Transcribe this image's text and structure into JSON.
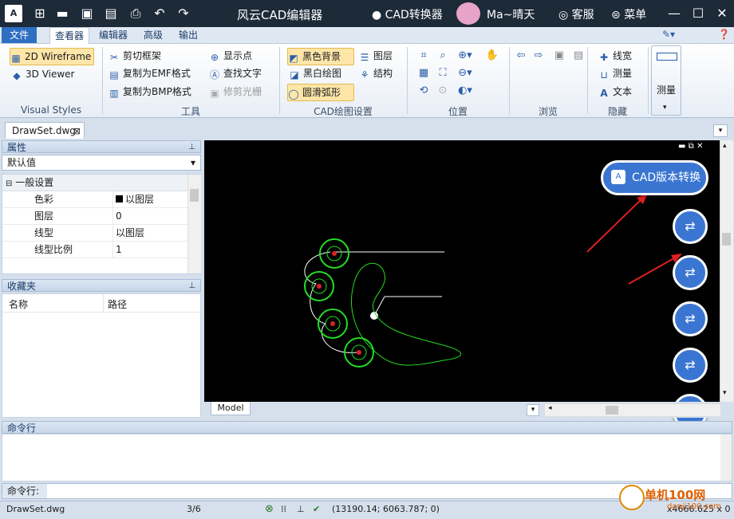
{
  "titlebar": {
    "logo": "A",
    "title": "风云CAD编辑器",
    "converter": "CAD转换器",
    "user": "Ma~晴天",
    "support": "客服",
    "menu": "菜单",
    "toolbar_icons": [
      "new-file-icon",
      "open-folder-icon",
      "save-icon",
      "save-as-icon",
      "print-icon",
      "undo-icon",
      "redo-icon"
    ]
  },
  "menubar": {
    "tabs": [
      "文件",
      "查看器",
      "编辑器",
      "高级",
      "输出"
    ],
    "active": "查看器"
  },
  "ribbon": {
    "visual_styles": {
      "label": "Visual Styles",
      "items": [
        "2D Wireframe",
        "3D Viewer"
      ]
    },
    "tools": {
      "label": "工具",
      "items": [
        "剪切框架",
        "复制为EMF格式",
        "复制为BMP格式",
        "显示点",
        "查找文字",
        "修剪光栅"
      ]
    },
    "cad_settings": {
      "label": "CAD绘图设置",
      "items": [
        "黑色背景",
        "黑白绘图",
        "圆滑弧形",
        "图层",
        "结构"
      ]
    },
    "position": {
      "label": "位置"
    },
    "browse": {
      "label": "浏览"
    },
    "hide": {
      "label": "隐藏",
      "items": [
        "线宽",
        "测量",
        "文本"
      ]
    },
    "measure": {
      "label": "测量"
    }
  },
  "document": {
    "tab": "DrawSet.dwg"
  },
  "properties": {
    "title": "属性",
    "dropdown": "默认值",
    "section": "一般设置",
    "rows": [
      {
        "name": "色彩",
        "value": "以图层"
      },
      {
        "name": "图层",
        "value": "0"
      },
      {
        "name": "线型",
        "value": "以图层"
      },
      {
        "name": "线型比例",
        "value": "1"
      }
    ]
  },
  "favorites": {
    "title": "收藏夹",
    "columns": [
      "名称",
      "路径"
    ]
  },
  "canvas": {
    "model_tab": "Model",
    "convert_button": "CAD版本转换"
  },
  "command": {
    "title": "命令行",
    "input_label": "命令行:"
  },
  "status": {
    "file": "DrawSet.dwg",
    "page": "3/6",
    "coords": "(13190.14; 6063.787; 0)",
    "right_coords": "x4666.625 x 0"
  },
  "watermark": {
    "text": "单机100网",
    "sub": "danji100.com"
  },
  "colors": {
    "accent": "#3a76d1",
    "titlebar": "#1d2a38",
    "plant": "#22dd22",
    "arrow": "#e02020"
  }
}
